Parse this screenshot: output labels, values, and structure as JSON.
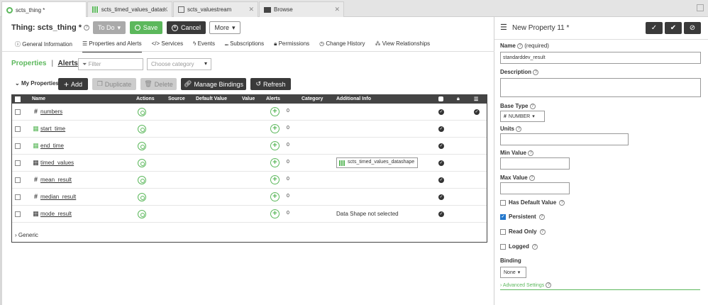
{
  "tabs": [
    {
      "label": "scts_thing *",
      "active": true
    },
    {
      "label": "scts_timed_values_datas...",
      "active": false
    },
    {
      "label": "scts_valuestream",
      "active": false
    },
    {
      "label": "Browse",
      "active": false
    }
  ],
  "header": {
    "title": "Thing: scts_thing *",
    "todo_label": "To Do",
    "save_label": "Save",
    "cancel_label": "Cancel",
    "more_label": "More"
  },
  "subtabs": [
    "General Information",
    "Properties and Alerts",
    "Services",
    "Events",
    "Subscriptions",
    "Permissions",
    "Change History",
    "View Relationships"
  ],
  "properties": {
    "props_label": "Properties",
    "alerts_label": "Alerts",
    "filter_placeholder": "Filter",
    "category_placeholder": "Choose category",
    "section_label": "My Properties",
    "add_label": "Add",
    "duplicate_label": "Duplicate",
    "delete_label": "Delete",
    "manage_bindings_label": "Manage Bindings",
    "refresh_label": "Refresh",
    "columns": [
      "Name",
      "Actions",
      "Source",
      "Default Value",
      "Value",
      "Alerts",
      "Category",
      "Additional Info"
    ],
    "rows": [
      {
        "name": "numbers",
        "type": "number",
        "alerts": "0",
        "info": "",
        "checked": true
      },
      {
        "name": "start_time",
        "type": "datetime",
        "alerts": "0",
        "info": "",
        "checked": false
      },
      {
        "name": "end_time",
        "type": "datetime",
        "alerts": "0",
        "info": "",
        "checked": false
      },
      {
        "name": "timed_values",
        "type": "infotable",
        "alerts": "0",
        "info": "scts_timed_values_datashape",
        "checked": false
      },
      {
        "name": "mean_result",
        "type": "number",
        "alerts": "0",
        "info": "",
        "checked": false
      },
      {
        "name": "median_result",
        "type": "number",
        "alerts": "0",
        "info": "",
        "checked": false
      },
      {
        "name": "mode_result",
        "type": "infotable",
        "alerts": "0",
        "info": "Data Shape not selected",
        "checked": false
      }
    ],
    "generic_label": "Generic"
  },
  "panel": {
    "title": "New Property 11 *",
    "name_label": "Name",
    "name_required": "(required)",
    "name_value": "standarddev_result",
    "description_label": "Description",
    "base_type_label": "Base Type",
    "base_type_value": "NUMBER",
    "units_label": "Units",
    "min_label": "Min Value",
    "max_label": "Max Value",
    "has_default_label": "Has Default Value",
    "persistent_label": "Persistent",
    "readonly_label": "Read Only",
    "logged_label": "Logged",
    "binding_label": "Binding",
    "binding_value": "None",
    "advanced_label": "Advanced Settings"
  },
  "colors": {
    "accent": "#5cb85c",
    "dark": "#3a3a3a"
  }
}
